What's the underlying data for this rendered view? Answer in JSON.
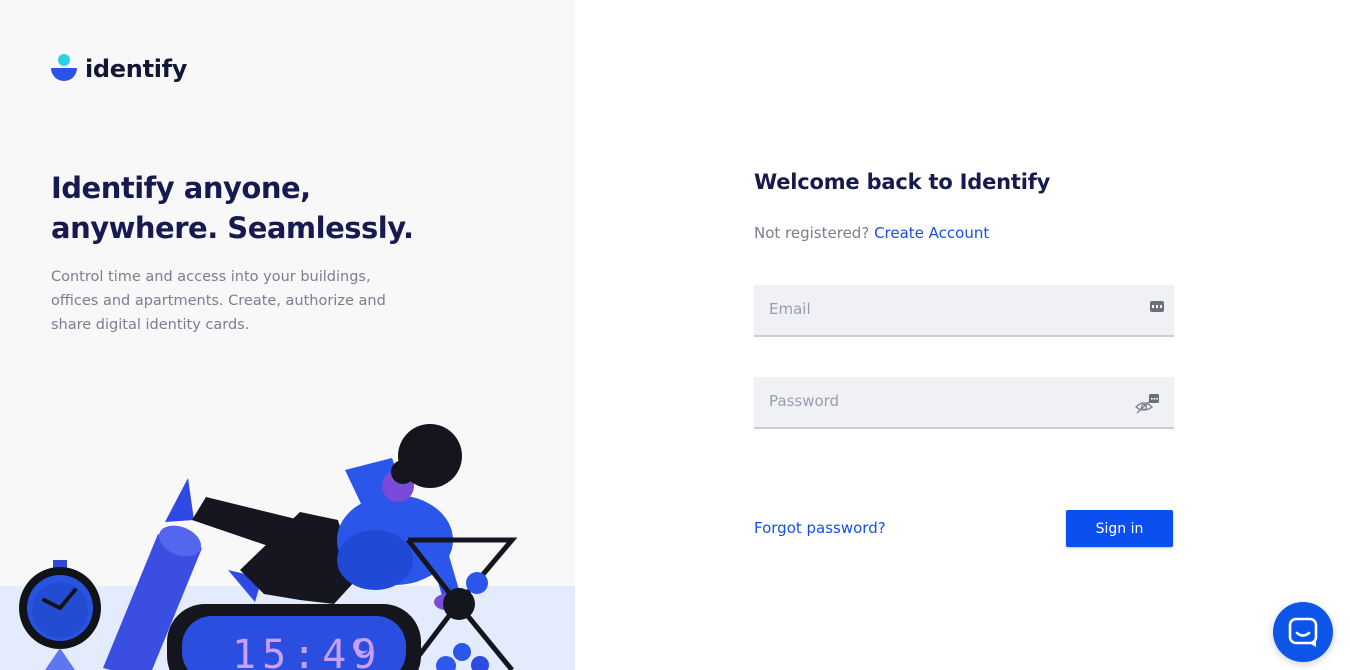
{
  "brand": {
    "name": "identify",
    "colors": {
      "primary": "#0b4ff0",
      "accent": "#27d3e8",
      "heading": "#161a4f"
    }
  },
  "hero": {
    "title": "Identify anyone, anywhere. Seamlessly.",
    "description": "Control time and access into your buildings, offices and apartments. Create, authorize and share digital identity cards.",
    "illustration": {
      "clock_display": "15:49"
    }
  },
  "login": {
    "title": "Welcome back to Identify",
    "register_prompt": "Not registered?",
    "register_link": "Create Account",
    "email": {
      "value": "",
      "placeholder": "Email"
    },
    "password": {
      "value": "",
      "placeholder": "Password"
    },
    "forgot_link": "Forgot password?",
    "submit_label": "Sign in"
  },
  "icons": {
    "email_field": "password-manager-key-icon",
    "password_field": "eye-off-icon",
    "chat": "chat-icon"
  }
}
